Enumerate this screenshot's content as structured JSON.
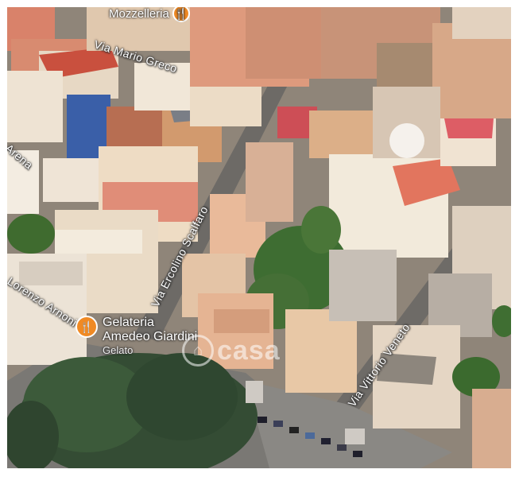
{
  "map": {
    "streets": [
      {
        "id": "via-mario-greco",
        "label": "Via Mario Greco"
      },
      {
        "id": "via-ercolino-scalfaro",
        "label": "Via Ercolino Scalfaro"
      },
      {
        "id": "via-vittorio-veneto",
        "label": "Via Vittorio Veneto"
      },
      {
        "id": "via-lorenzo-arnoni",
        "label": "Lorenzo Arnoni"
      },
      {
        "id": "via-arena",
        "label": "Arena"
      }
    ],
    "pois": [
      {
        "id": "mozzelleria",
        "name": "Mozzelleria"
      },
      {
        "id": "gelateria",
        "name_line1": "Gelateria",
        "name_line2": "Amedeo Giardini",
        "category": "Gelato"
      }
    ],
    "watermark": "casa",
    "poi_color": "#f08a24"
  }
}
